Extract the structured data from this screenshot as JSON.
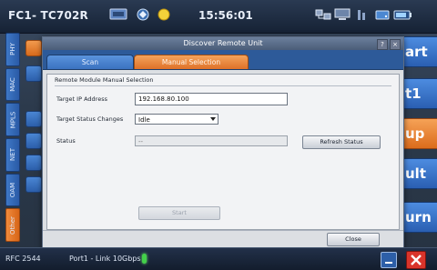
{
  "topbar": {
    "device_title": "FC1- TC702R",
    "clock": "15:56:01"
  },
  "left_tabs": [
    "PHY",
    "MAC",
    "MPLS",
    "NET",
    "OAM",
    "Other"
  ],
  "right_buttons": [
    {
      "label": "art",
      "color": "#3c73c4"
    },
    {
      "label": "t1",
      "color": "#3c73c4"
    },
    {
      "label": "up",
      "color": "#e27a2a"
    },
    {
      "label": "ult",
      "color": "#3c73c4"
    },
    {
      "label": "urn",
      "color": "#3c73c4"
    }
  ],
  "dialog": {
    "title": "Discover Remote Unit",
    "help_label": "?",
    "close_label": "×",
    "tabs": {
      "scan": "Scan",
      "manual": "Manual Selection"
    },
    "group_title": "Remote Module Manual Selection",
    "target_ip_label": "Target IP Address",
    "target_ip_value": "192.168.80.100",
    "target_status_label": "Target Status Changes",
    "target_status_value": "Idle",
    "status_label": "Status",
    "status_value": "--",
    "refresh_button": "Refresh Status",
    "start_button": "Start",
    "close_button": "Close"
  },
  "bottombar": {
    "rfc": "RFC 2544",
    "port": "Port1 - Link 10Gbps"
  },
  "colors": {
    "accent_orange": "#e27a2a",
    "accent_blue": "#3c73c4",
    "close_red": "#d9342b"
  }
}
